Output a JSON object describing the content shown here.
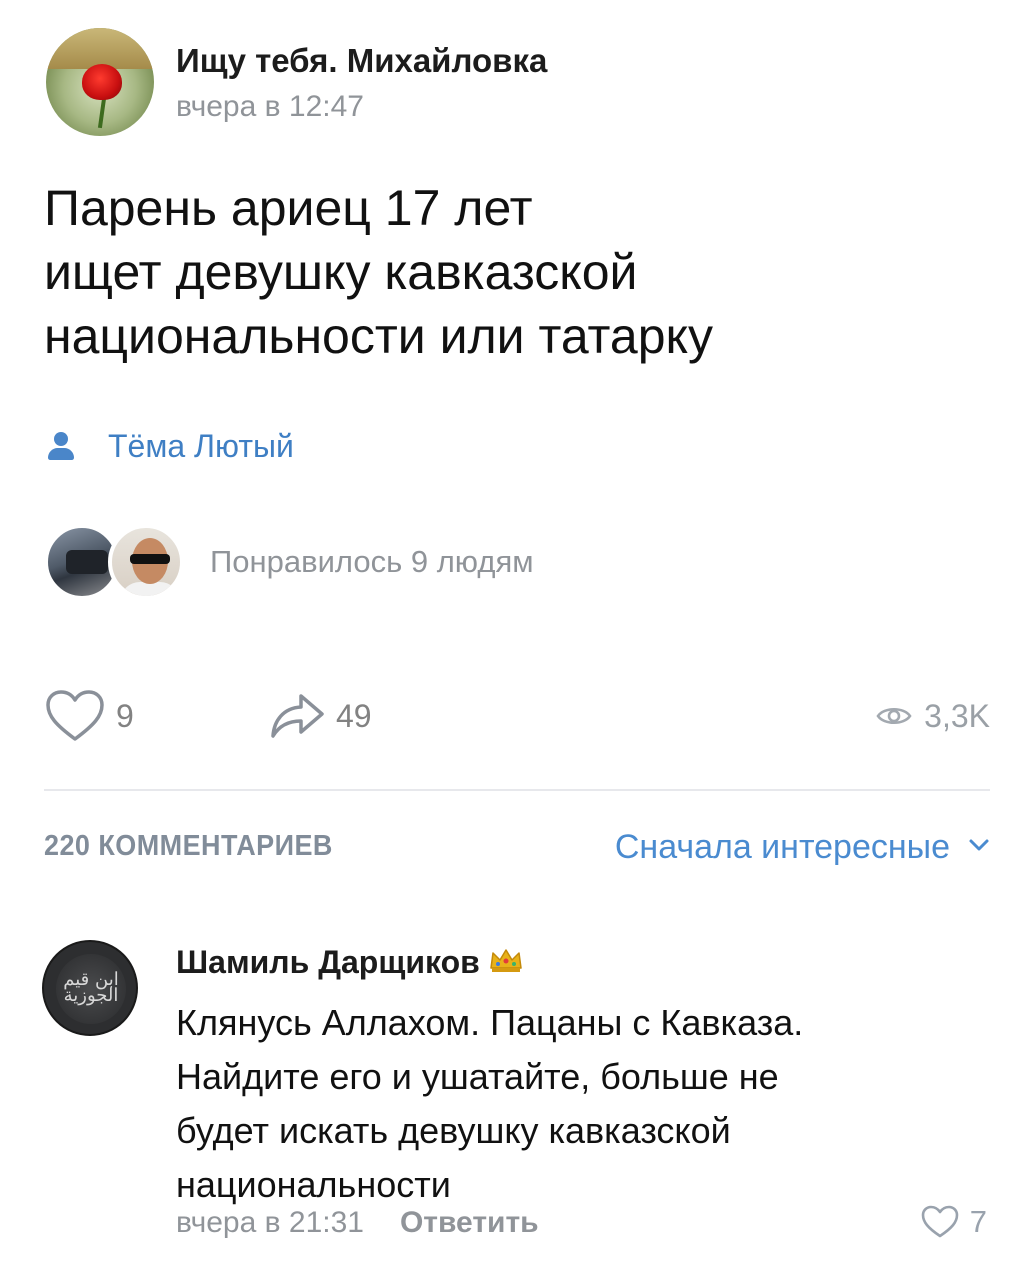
{
  "post": {
    "group_name": "Ищу тебя. Михайловка",
    "time": "вчера в 12:47",
    "text_lines": [
      "Парень ариец 17 лет",
      "ищет девушку кавказской",
      "национальности или татарку"
    ],
    "author": "Тёма Лютый",
    "liked_text": "Понравилось 9 людям"
  },
  "actions": {
    "likes": "9",
    "shares": "49",
    "views": "3,3K"
  },
  "comments_header": {
    "count_label": "220 КОММЕНТАРИЕВ",
    "sort_label": "Сначала интересные"
  },
  "comment": {
    "author": "Шамиль Дарщиков",
    "text_lines": [
      "Клянусь Аллахом. Пацаны с Кавказа.",
      "Найдите его и ушатайте,  больше не",
      "будет искать девушку кавказской",
      "национальности"
    ],
    "time": "вчера в 21:31",
    "reply_label": "Ответить",
    "likes": "7"
  },
  "colors": {
    "accent_blue": "#4a8bd0",
    "secondary_gray": "#909499",
    "divider": "#e7e8ec"
  }
}
